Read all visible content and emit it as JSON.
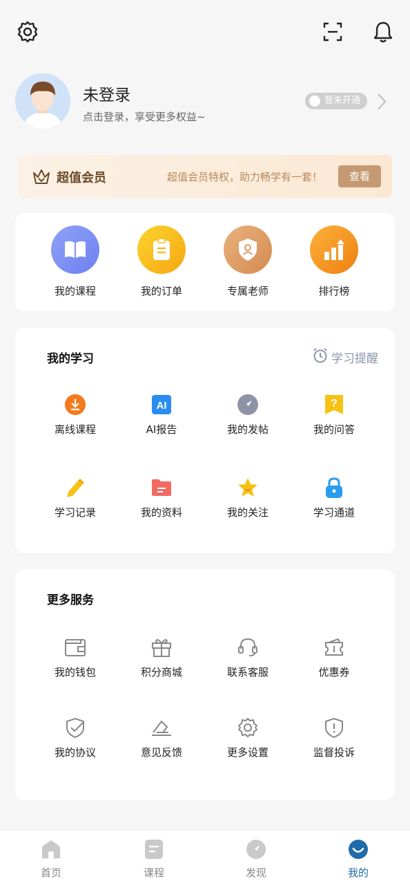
{
  "profile": {
    "name": "未登录",
    "subtitle": "点击登录，享受更多权益~",
    "vip_status": "暂未开通"
  },
  "member_banner": {
    "title": "超值会员",
    "description": "超值会员特权，助力畅学有一套！",
    "button": "查看"
  },
  "quick_actions": [
    {
      "label": "我的课程",
      "icon": "book-icon",
      "color": "#7b8ff5"
    },
    {
      "label": "我的订单",
      "icon": "clipboard-icon",
      "color": "#f7bd1d"
    },
    {
      "label": "专属老师",
      "icon": "teacher-shield-icon",
      "color": "#d99a63"
    },
    {
      "label": "排行榜",
      "icon": "ranking-icon",
      "color": "#f59a22"
    }
  ],
  "my_study": {
    "title": "我的学习",
    "reminder": "学习提醒",
    "items": [
      {
        "label": "离线课程",
        "icon": "download-icon"
      },
      {
        "label": "AI报告",
        "icon": "ai-report-icon"
      },
      {
        "label": "我的发帖",
        "icon": "compass-icon"
      },
      {
        "label": "我的问答",
        "icon": "question-icon"
      },
      {
        "label": "学习记录",
        "icon": "pencil-icon"
      },
      {
        "label": "我的资料",
        "icon": "folder-icon"
      },
      {
        "label": "我的关注",
        "icon": "star-icon"
      },
      {
        "label": "学习通道",
        "icon": "lock-icon"
      }
    ]
  },
  "more_services": {
    "title": "更多服务",
    "items": [
      {
        "label": "我的钱包",
        "icon": "wallet-icon"
      },
      {
        "label": "积分商城",
        "icon": "gift-icon"
      },
      {
        "label": "联系客服",
        "icon": "headset-icon"
      },
      {
        "label": "优惠券",
        "icon": "coupon-icon"
      },
      {
        "label": "我的协议",
        "icon": "shield-check-icon"
      },
      {
        "label": "意见反馈",
        "icon": "feedback-icon"
      },
      {
        "label": "更多设置",
        "icon": "settings-icon"
      },
      {
        "label": "监督投诉",
        "icon": "shield-alert-icon"
      }
    ]
  },
  "tabbar": {
    "items": [
      {
        "label": "首页",
        "icon": "home-icon"
      },
      {
        "label": "课程",
        "icon": "course-icon"
      },
      {
        "label": "发现",
        "icon": "discover-icon"
      },
      {
        "label": "我的",
        "icon": "profile-icon"
      }
    ],
    "active_color": "#1f6bab",
    "inactive_color": "#888888"
  }
}
